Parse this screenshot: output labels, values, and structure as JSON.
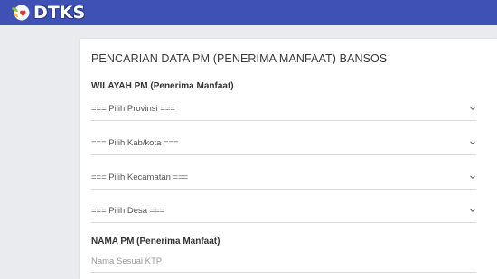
{
  "header": {
    "logo_text": "DTKS",
    "logo_icon": "dtks-logo-icon"
  },
  "form": {
    "title": "PENCARIAN DATA PM (PENERIMA MANFAAT) BANSOS",
    "wilayah_label": "WILAYAH PM (Penerima Manfaat)",
    "provinsi_selected": "=== Pilih Provinsi ===",
    "kabkota_selected": "=== Pilih Kab/kota ===",
    "kecamatan_selected": "=== Pilih Kecamatan ===",
    "desa_selected": "=== Pilih Desa ===",
    "nama_label": "NAMA PM (Penerima Manfaat)",
    "nama_placeholder": "Nama Sesuai KTP",
    "nama_value": "",
    "dropdown_icon": "chevron-down-icon"
  },
  "colors": {
    "header_bg": "#3f51b5",
    "page_bg": "#e9ebee",
    "card_bg": "#ffffff"
  }
}
